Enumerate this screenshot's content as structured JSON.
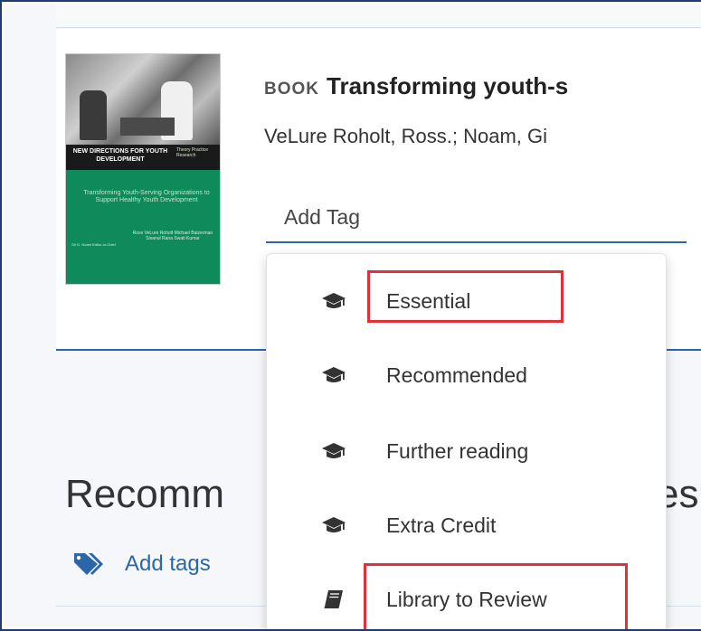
{
  "record": {
    "type_label": "BOOK",
    "title": "Transforming youth-s",
    "authors": "VeLure Roholt, Ross.; Noam, Gi"
  },
  "cover": {
    "series": "NEW DIRECTIONS FOR YOUTH DEVELOPMENT",
    "series_right": "Theory Practice Research",
    "book_title": "Transforming Youth-Serving Organizations to Support Healthy Youth Development",
    "editors": "Ross VeLure Roholt Michael Baizerman Sivanul Rana Swati Kumar",
    "issue_editor": "Gil G. Noam Editor-in-Chief"
  },
  "tag_input": {
    "placeholder": "Add Tag"
  },
  "dropdown": {
    "items": [
      {
        "label": "Essential",
        "icon": "graduation-cap-icon"
      },
      {
        "label": "Recommended",
        "icon": "graduation-cap-icon"
      },
      {
        "label": "Further reading",
        "icon": "graduation-cap-icon"
      },
      {
        "label": "Extra Credit",
        "icon": "graduation-cap-icon"
      },
      {
        "label": "Library to Review",
        "icon": "book-icon"
      }
    ]
  },
  "section": {
    "heading_start": "Recomm",
    "heading_end": "es",
    "add_tags_label": "Add tags",
    "add_tags_icon": "tags-icon"
  },
  "colors": {
    "accent": "#2b66a8",
    "highlight": "#e0303b",
    "cover_green": "#0f8a5a"
  }
}
